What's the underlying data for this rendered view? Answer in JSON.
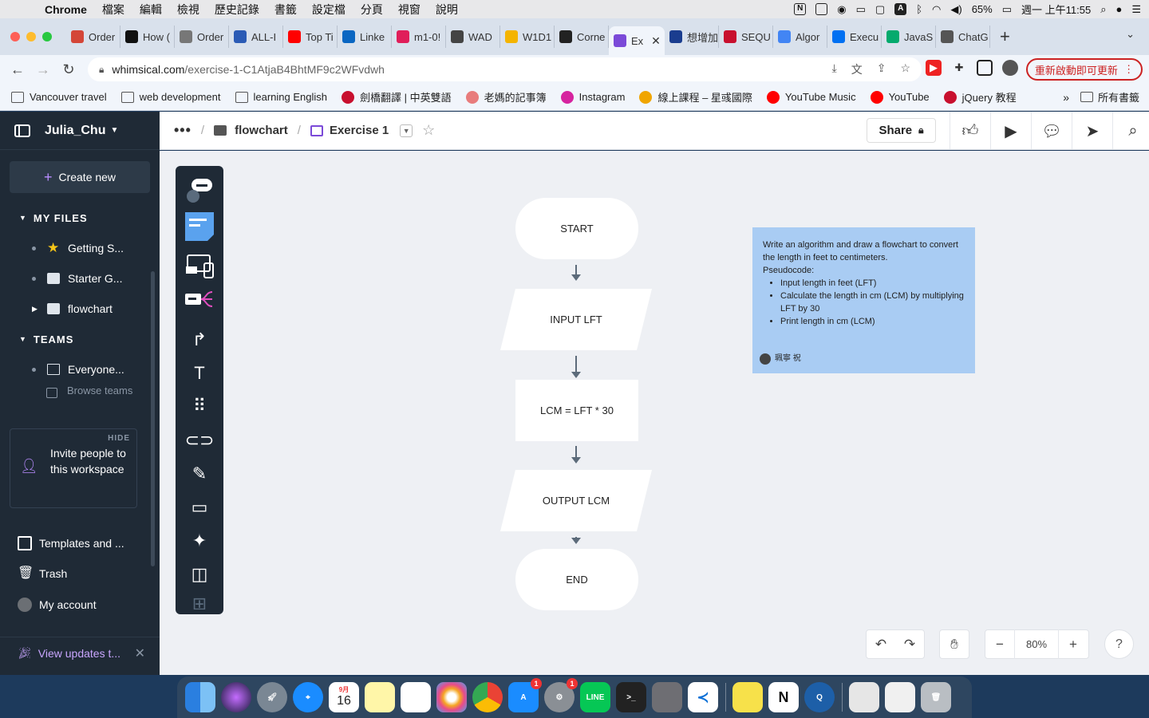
{
  "menubar": {
    "app_name": "Chrome",
    "menus": [
      "檔案",
      "編輯",
      "檢視",
      "歷史記錄",
      "書籤",
      "設定檔",
      "分頁",
      "視窗",
      "說明"
    ],
    "battery": "65%",
    "clock": "週一 上午11:55"
  },
  "tabs": [
    {
      "label": "Order",
      "color": "#d44638"
    },
    {
      "label": "How (",
      "color": "#111111"
    },
    {
      "label": "Order",
      "color": "#777777"
    },
    {
      "label": "ALL-I",
      "color": "#2b5bb5"
    },
    {
      "label": "Top Ti",
      "color": "#ff0000"
    },
    {
      "label": "Linke",
      "color": "#0a66c2"
    },
    {
      "label": "m1-0!",
      "color": "#e01e5a"
    },
    {
      "label": "WAD",
      "color": "#444444"
    },
    {
      "label": "W1D1",
      "color": "#f4b400"
    },
    {
      "label": "Corne",
      "color": "#222222"
    },
    {
      "label": "Ex",
      "color": "#7b4ad8"
    },
    {
      "label": "想增加",
      "color": "#1a3d8f"
    },
    {
      "label": "SEQU",
      "color": "#c8102e"
    },
    {
      "label": "Algor",
      "color": "#4285f4"
    },
    {
      "label": "Execu",
      "color": "#0070f2"
    },
    {
      "label": "JavaS",
      "color": "#04aa6d"
    },
    {
      "label": "ChatG",
      "color": "#555555"
    }
  ],
  "address": {
    "domain": "whimsical.com",
    "path": "/exercise-1-C1AtjaB4BhtMF9c2WFvdwh",
    "restart_label": "重新啟動即可更新"
  },
  "bookmarks": [
    {
      "label": "Vancouver travel",
      "icon": "folder-icon"
    },
    {
      "label": "web development",
      "icon": "folder-icon"
    },
    {
      "label": "learning English",
      "icon": "folder-icon"
    },
    {
      "label": "劍橋翻譯 | 中英雙語",
      "icon": "cambridge-icon"
    },
    {
      "label": "老媽的記事簿",
      "icon": "doll-icon"
    },
    {
      "label": "Instagram",
      "icon": "instagram-icon"
    },
    {
      "label": "線上課程 – 星彧國際",
      "icon": "course-icon"
    },
    {
      "label": "YouTube Music",
      "icon": "youtube-music-icon"
    },
    {
      "label": "YouTube",
      "icon": "youtube-icon"
    },
    {
      "label": "jQuery 教程",
      "icon": "jquery-icon"
    }
  ],
  "bookmarks_more": "»",
  "bookmarks_all": "所有書籤",
  "sidebar": {
    "workspace": "Julia_Chu",
    "create_new": "Create new",
    "my_files_heading": "MY FILES",
    "files": [
      "Getting S...",
      "Starter G...",
      "flowchart"
    ],
    "teams_heading": "TEAMS",
    "teams": [
      "Everyone..."
    ],
    "browse_teams": "Browse teams",
    "invite_hide": "HIDE",
    "invite_text": "Invite people to this workspace",
    "templates": "Templates and ...",
    "trash": "Trash",
    "account": "My account",
    "updates": "View updates t..."
  },
  "topbar": {
    "more": "•••",
    "folder": "flowchart",
    "board": "Exercise 1",
    "share": "Share"
  },
  "flowchart": {
    "start": "START",
    "input": "INPUT LFT",
    "process": "LCM = LFT * 30",
    "output": "OUTPUT LCM",
    "end": "END"
  },
  "note": {
    "intro": "Write an algorithm and draw a flowchart to convert the length in feet to centimeters.",
    "pseudo_label": "Pseudocode:",
    "steps": [
      "Input length in feet (LFT)",
      "Calculate the length in cm (LCM) by multiplying LFT by 30",
      "Print length in cm (LCM)"
    ],
    "author": "珮寧 祝"
  },
  "zoom": "80%",
  "help": "?",
  "dock": {
    "calendar_month": "9月",
    "calendar_day": "16",
    "appstore_badge": "1",
    "settings_badge": "1"
  }
}
